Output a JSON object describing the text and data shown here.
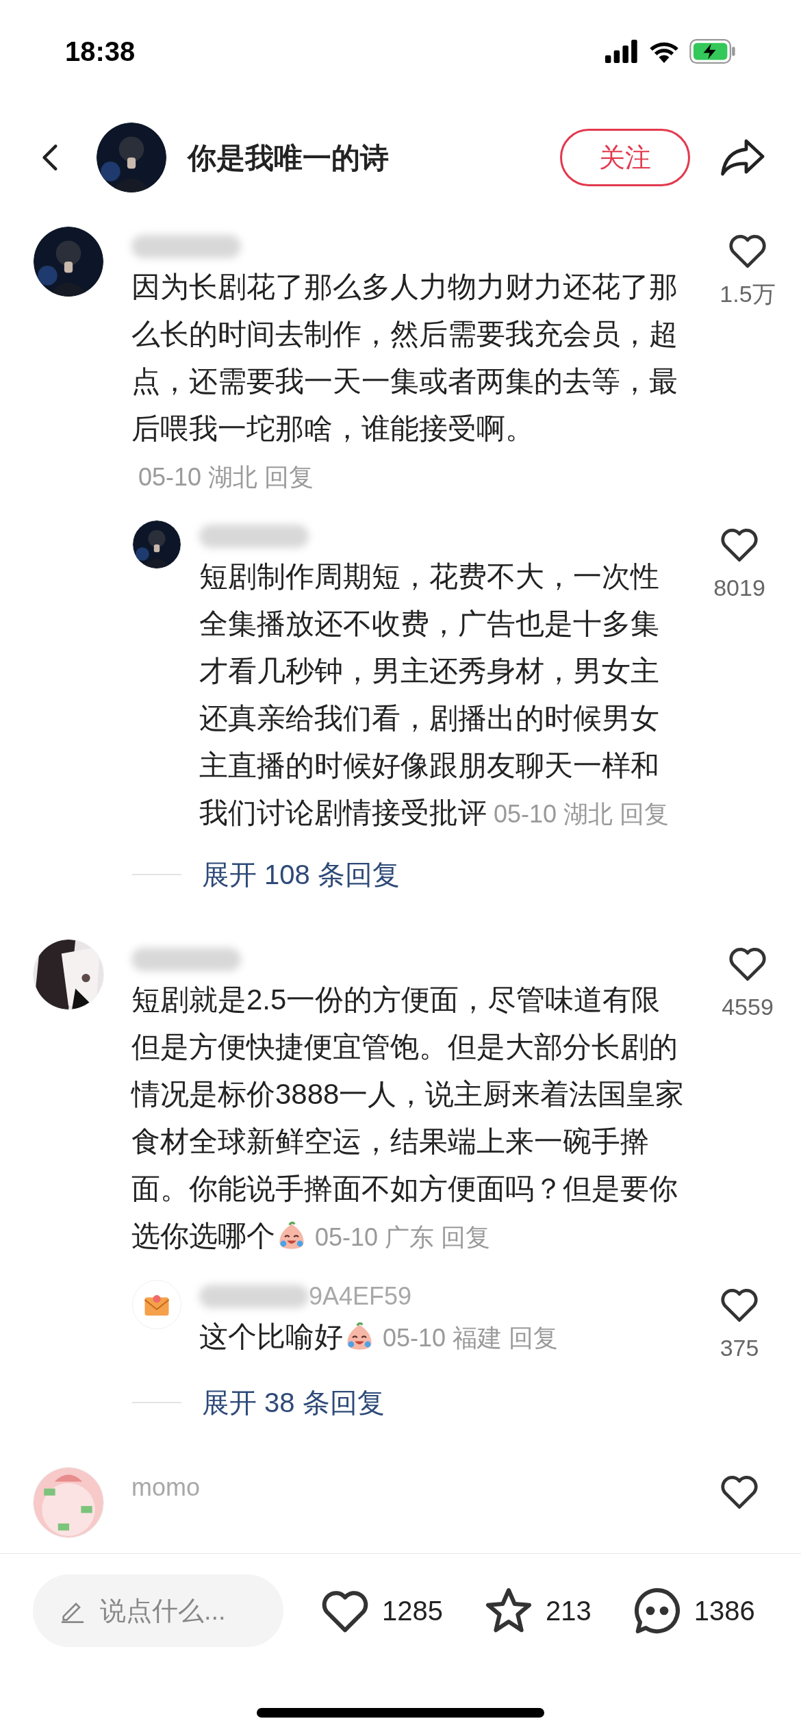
{
  "status_bar": {
    "time": "18:38"
  },
  "header": {
    "title": "你是我唯一的诗",
    "follow_label": "关注"
  },
  "comments": [
    {
      "name_blurred": true,
      "text": "因为长剧花了那么多人力物力财力还花了那么长的时间去制作，然后需要我充会员，超点，还需要我一天一集或者两集的去等，最后喂我一坨那啥，谁能接受啊。",
      "emoji": false,
      "date": "05-10",
      "region": "湖北",
      "reply_label": "回复",
      "likes": "1.5万",
      "replies": [
        {
          "name_blurred": true,
          "text": "短剧制作周期短，花费不大，一次性全集播放还不收费，广告也是十多集才看几秒钟，男主还秀身材，男女主还真亲给我们看，剧播出的时候男女主直播的时候好像跟朋友聊天一样和我们讨论剧情接受批评",
          "emoji": false,
          "date": "05-10",
          "region": "湖北",
          "reply_label": "回复",
          "likes": "8019"
        }
      ],
      "expand_label": "展开 108 条回复"
    },
    {
      "name_blurred": true,
      "text": "短剧就是2.5一份的方便面，尽管味道有限但是方便快捷便宜管饱。但是大部分长剧的情况是标价3888一人，说主厨来着法国皇家食材全球新鲜空运，结果端上来一碗手擀面。你能说手擀面不如方便面吗？但是要你选你选哪个",
      "emoji": true,
      "date": "05-10",
      "region": "广东",
      "reply_label": "回复",
      "likes": "4559",
      "replies": [
        {
          "name_blurred": true,
          "name": "9A4EF59",
          "text": "这个比喻好",
          "emoji": true,
          "date": "05-10",
          "region": "福建",
          "reply_label": "回复",
          "likes": "375"
        }
      ],
      "expand_label": "展开 38 条回复"
    },
    {
      "name_blurred": false,
      "name": "momo"
    }
  ],
  "bottom_bar": {
    "placeholder": "说点什么...",
    "likes": "1285",
    "stars": "213",
    "comments": "1386"
  }
}
